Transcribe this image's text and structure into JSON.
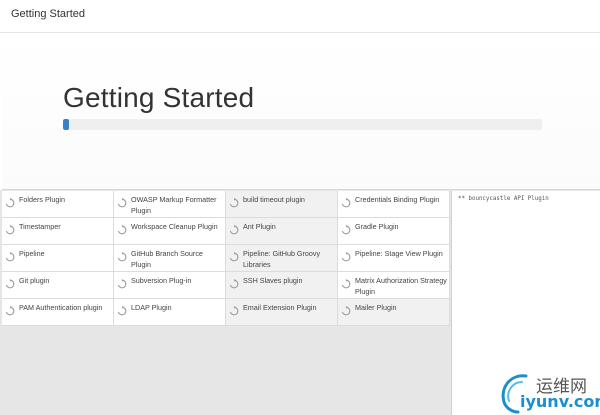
{
  "window": {
    "title": "Getting Started"
  },
  "hero": {
    "heading": "Getting Started",
    "progress_percent": 1.2
  },
  "plugins": [
    [
      "Folders Plugin",
      "OWASP Markup Formatter Plugin",
      "build timeout plugin",
      "Credentials Binding Plugin"
    ],
    [
      "Timestamper",
      "Workspace Cleanup Plugin",
      "Ant Plugin",
      "Gradle Plugin"
    ],
    [
      "Pipeline",
      "GitHub Branch Source Plugin",
      "Pipeline: GitHub Groovy Libraries",
      "Pipeline: Stage View Plugin"
    ],
    [
      "Git plugin",
      "Subversion Plug-in",
      "SSH Slaves plugin",
      "Matrix Authorization Strategy Plugin"
    ],
    [
      "PAM Authentication plugin",
      "LDAP Plugin",
      "Email Extension Plugin",
      "Mailer Plugin"
    ]
  ],
  "log": {
    "text": "** bouncycastle API Plugin"
  },
  "watermark": {
    "cn": "运维网",
    "url": "iyunv.com"
  },
  "icons": {
    "status": "refresh-icon"
  },
  "colors": {
    "accent": "#3a80c9",
    "watermark": "#1a8fd0"
  }
}
